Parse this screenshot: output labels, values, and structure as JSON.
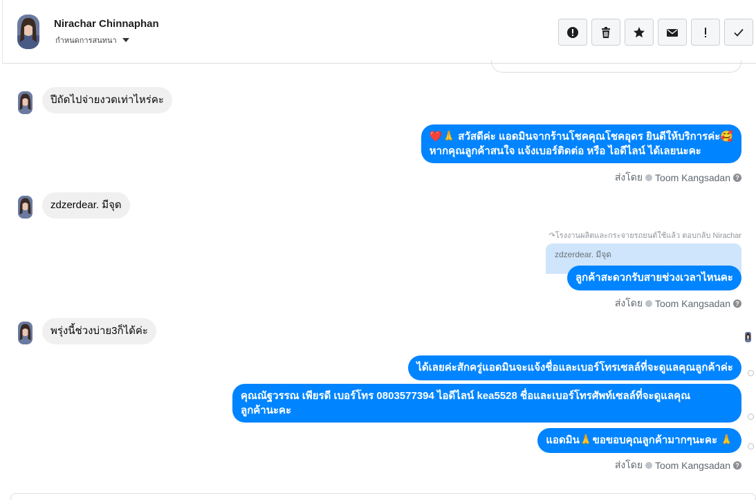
{
  "header": {
    "contact_name": "Nirachar Chinnaphan",
    "assign_label": "กำหนดการสนทนา",
    "actions": [
      {
        "name": "spam-button",
        "icon": "exclamation-circle-icon"
      },
      {
        "name": "delete-button",
        "icon": "trash-icon"
      },
      {
        "name": "star-button",
        "icon": "star-icon"
      },
      {
        "name": "mark-unread-button",
        "icon": "envelope-icon"
      },
      {
        "name": "follow-up-button",
        "icon": "exclamation-icon"
      },
      {
        "name": "mark-done-button",
        "icon": "checkmark-icon"
      }
    ]
  },
  "messages": {
    "in_1": "ปีถัดไปจ่ายงวดเท่าไหร่คะ",
    "out_1_line1": "❤️🙏 สวัสดีค่ะ แอดมินจากร้านโชคคุณโชคอุดร ยินดีให้บริการค่ะ🥰",
    "out_1_line2": "หากคุณลูกค้าสนใจ แจ้งเบอร์ติดต่อ หรือ ไอดีไลน์ ได้เลยนะคะ",
    "in_2": "zdzerdear. มีจุด",
    "reply_meta": "↷โรงงานผลิตและกระจายรถยนต์ใช้แล้ว ตอบกลับ Nirachar",
    "quoted_text": "zdzerdear. มีจุด",
    "out_2": "ลูกค้าสะดวกรับสายช่วงเวลาไหนคะ",
    "in_3": "พรุ่งนี้ช่วงบ่าย3ก็ได้ค่ะ",
    "out_3": "ได้เลยค่ะสักครู่แอดมินจะแจ้งชื่อและเบอร์โทรเซลล์ที่จะดูแลคุณลูกค้าค่ะ",
    "out_4_line1": "คุณณัฐวรรณ เพียรดี        เบอร์โทร 0803577394  ไอดีไลน์ kea5528 ชื่อและเบอร์โทรศัพท์เซลล์ที่จะดูแลคุณ",
    "out_4_line2": "ลูกค้านะคะ",
    "out_5": "แอดมิน🙏ขอขอบคุณลูกค้ามากๆนะคะ 🙏"
  },
  "sent_by": {
    "prefix": "ส่งโดย",
    "agent": "Toom Kangsadan",
    "help": "?"
  },
  "colors": {
    "outgoing_bubble": "#0084ff",
    "incoming_bubble": "#f0f0f0",
    "quote_background": "#cfe5fb"
  }
}
